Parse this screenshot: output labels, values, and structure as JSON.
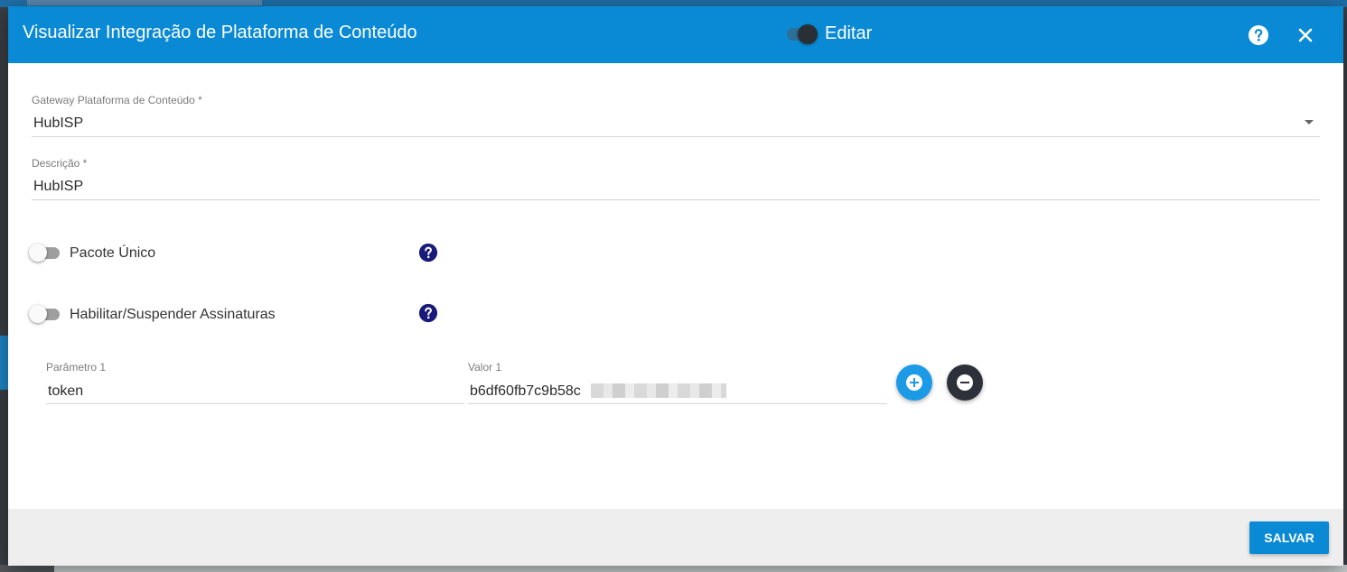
{
  "dialog": {
    "title": "Visualizar Integração de Plataforma de Conteúdo",
    "edit_label": "Editar",
    "edit_enabled": true
  },
  "form": {
    "gateway": {
      "label": "Gateway Plataforma de Conteúdo *",
      "value": "HubISP"
    },
    "descricao": {
      "label": "Descrição *",
      "value": "HubISP"
    },
    "pacote_unico": {
      "label": "Pacote Único",
      "enabled": false
    },
    "habilitar_suspender": {
      "label": "Habilitar/Suspender Assinaturas",
      "enabled": false
    },
    "parametros": [
      {
        "param_label": "Parâmetro 1",
        "param_value": "token",
        "valor_label": "Valor 1",
        "valor_value": "b6df60fb7c9b58c"
      }
    ]
  },
  "footer": {
    "save_label": "SALVAR"
  },
  "colors": {
    "primary": "#0a8ad5",
    "add_button": "#1b9ae6",
    "remove_button": "#2c3038",
    "help_icon": "#1a1a7a"
  },
  "icons": {
    "help_header": "help-circle-icon",
    "close": "close-icon",
    "help_field": "question-circle-icon",
    "add": "plus-circle-icon",
    "remove": "minus-circle-icon"
  }
}
